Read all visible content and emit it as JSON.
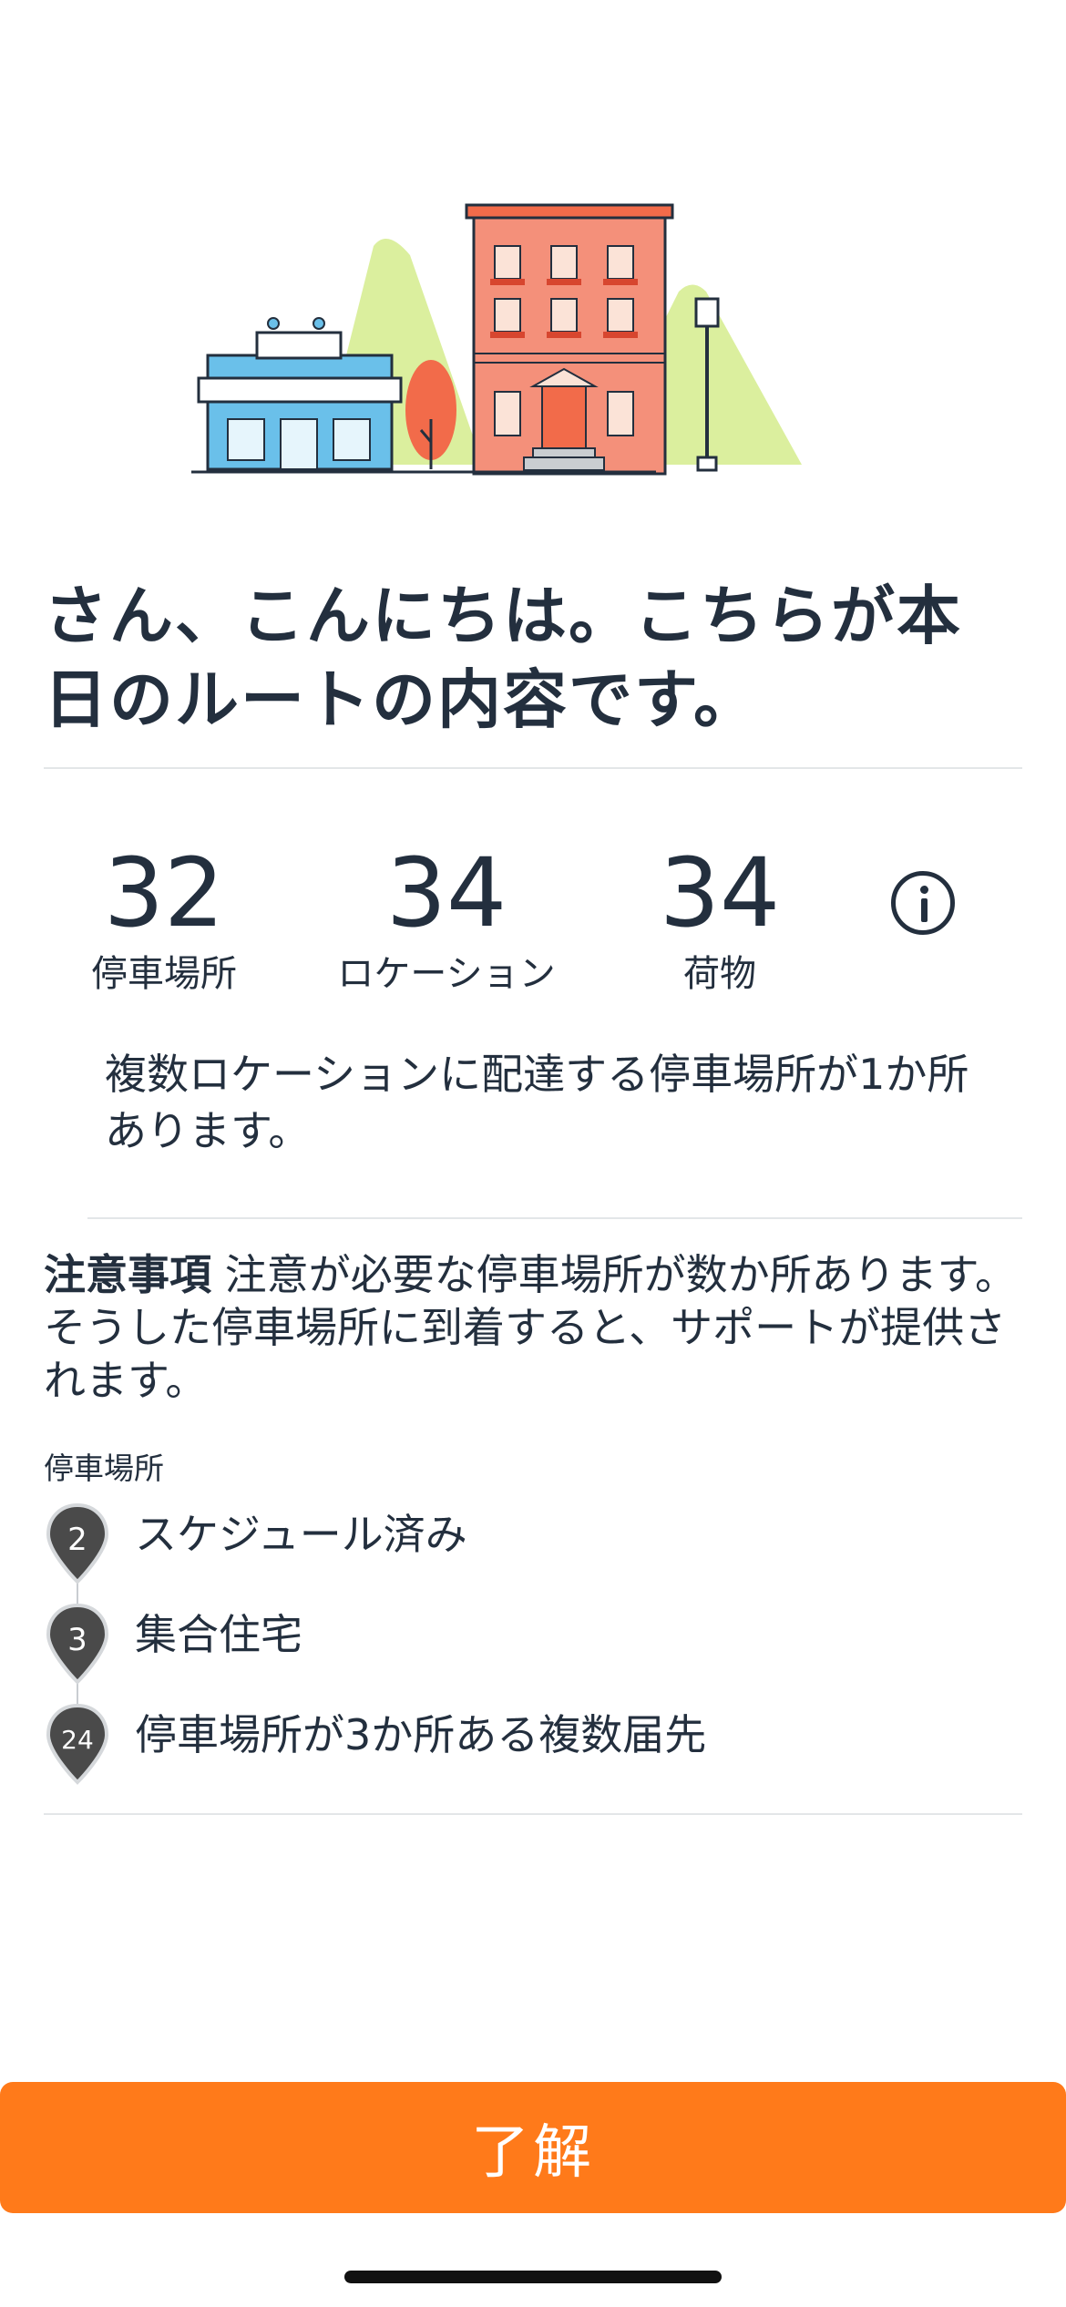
{
  "greeting": "さん、こんにちは。こちらが本日のルートの内容です。",
  "stats": [
    {
      "value": "32",
      "label": "停車場所"
    },
    {
      "value": "34",
      "label": "ロケーション"
    },
    {
      "value": "34",
      "label": "荷物"
    }
  ],
  "multi_location_note": "複数ロケーションに配達する停車場所が1か所あります。",
  "caution": {
    "title": "注意事項",
    "text": " 注意が必要な停車場所が数か所あります。そうした停車場所に到着すると、サポートが提供されます。"
  },
  "stops_label": "停車場所",
  "stops": [
    {
      "number": "2",
      "label": "スケジュール済み"
    },
    {
      "number": "3",
      "label": "集合住宅"
    },
    {
      "number": "24",
      "label": "停車場所が3か所ある複数届先"
    }
  ],
  "ok_button": "了解",
  "colors": {
    "accent": "#ff7a1a",
    "text": "#232f3e",
    "pin": "#4a4a4a"
  },
  "icons": [
    "info-icon",
    "map-pin-icon"
  ]
}
